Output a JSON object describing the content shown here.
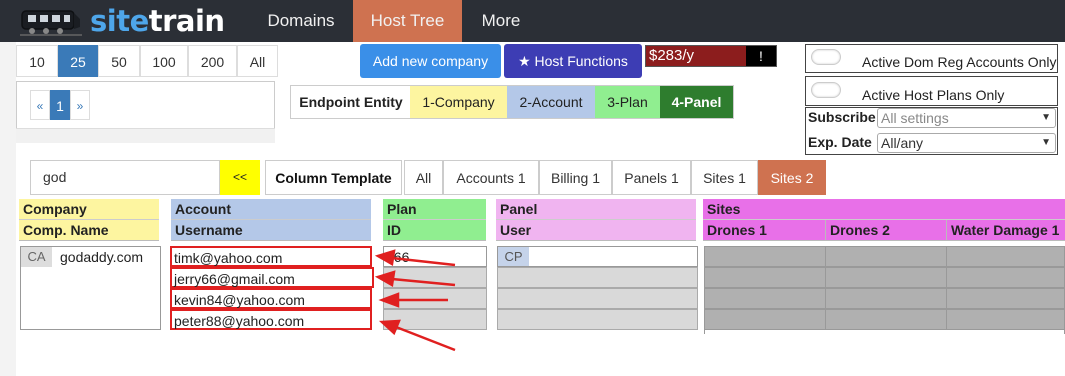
{
  "app": {
    "brand_part1": "site",
    "brand_part2": "train"
  },
  "nav": {
    "tabs": [
      {
        "label": "Domains"
      },
      {
        "label": "Host Tree"
      },
      {
        "label": "More"
      }
    ],
    "active": "Host Tree"
  },
  "page_size": {
    "options": [
      "10",
      "25",
      "50",
      "100",
      "200",
      "All"
    ],
    "selected": "25"
  },
  "pager": {
    "prev": "«",
    "current": "1",
    "next": "»"
  },
  "buttons": {
    "add_company": "Add new company",
    "host_functions": "Host Functions",
    "host_functions_icon": "★"
  },
  "price": {
    "value": "$283/y",
    "alert": "!"
  },
  "endpoint": {
    "label": "Endpoint Entity",
    "options": [
      "1-Company",
      "2-Account",
      "3-Plan",
      "4-Panel"
    ],
    "selected": "4-Panel"
  },
  "filters": {
    "active_dom_reg": "Active Dom Reg Accounts Only",
    "active_host_plans": "Active Host Plans Only",
    "subscribe_label": "Subscribe",
    "subscribe_value": "All settings",
    "exp_label": "Exp. Date",
    "exp_value": "All/any"
  },
  "search": {
    "value": "god",
    "button": "<<"
  },
  "column_template": {
    "label": "Column Template",
    "tabs": [
      "All",
      "Accounts 1",
      "Billing 1",
      "Panels 1",
      "Sites 1",
      "Sites 2"
    ],
    "selected": "Sites 2"
  },
  "grid": {
    "company": {
      "group": "Company",
      "column": "Comp. Name",
      "badge": "CA",
      "name": "godaddy.com"
    },
    "account": {
      "group": "Account",
      "column": "Username",
      "rows": [
        "timk@yahoo.com",
        "jerry66@gmail.com",
        "kevin84@yahoo.com",
        "peter88@yahoo.com"
      ]
    },
    "plan": {
      "group": "Plan",
      "column": "ID",
      "first_id": "466"
    },
    "panel": {
      "group": "Panel",
      "column": "User",
      "badge": "CP"
    },
    "sites": {
      "group": "Sites",
      "columns": [
        "Drones 1",
        "Drones 2",
        "Water Damage 1"
      ]
    }
  },
  "colors": {
    "nav_bg": "#2b2f36",
    "active_tab": "#cf7250",
    "primary": "#3a7ab8",
    "company": "#fdf5a0",
    "account": "#b4c8e8",
    "plan": "#90ee90",
    "panel": "#f0b4f0",
    "sites": "#e870e8",
    "highlight": "#e02020"
  }
}
